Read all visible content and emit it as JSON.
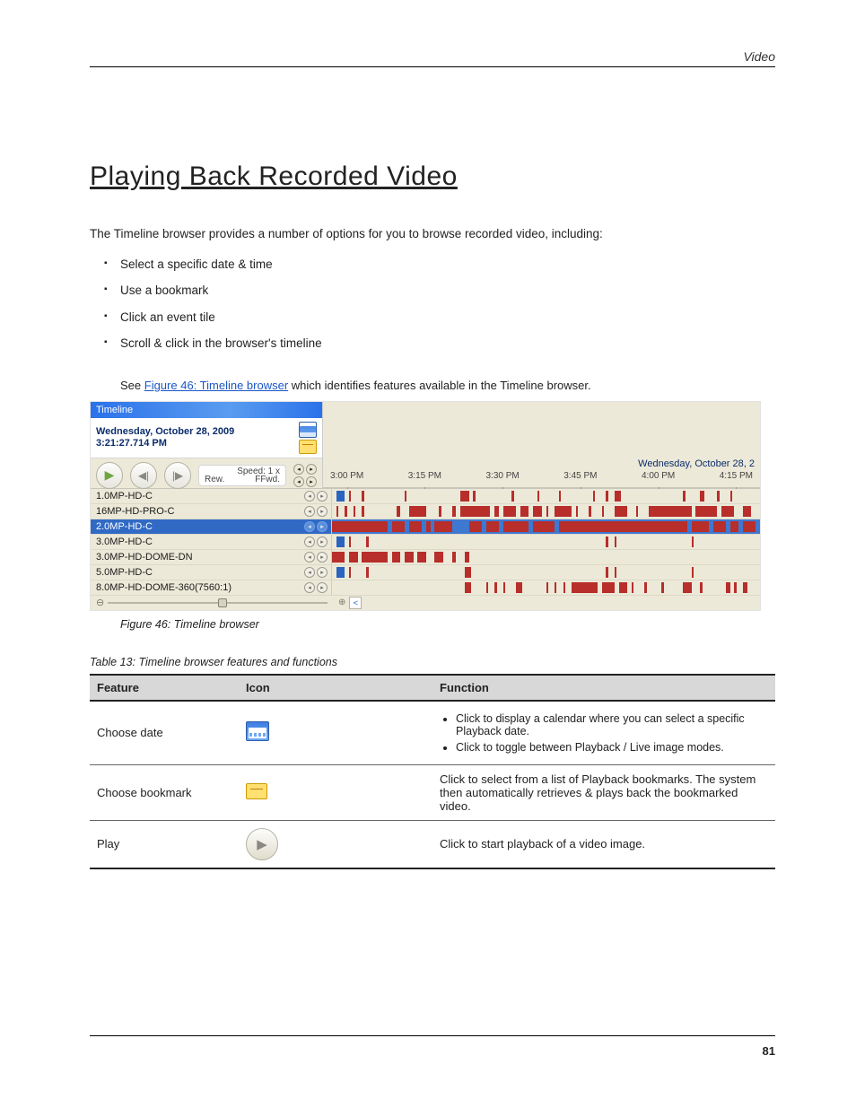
{
  "header": {
    "section": "Video"
  },
  "title": "Playing Back Recorded Video",
  "intro": {
    "para": "The Timeline browser provides a number of options for you to browse recorded video, including:",
    "bullets": [
      "Select a specific date & time",
      "Use a bookmark",
      "Click an event tile",
      "Scroll & click in the browser's timeline"
    ]
  },
  "caption": {
    "seePrefix": "See ",
    "figref": "Figure 46: Timeline browser",
    "after": " which identifies features available in the Timeline browser."
  },
  "screenshot": {
    "titlebar": "Timeline",
    "date": "Wednesday, October 28, 2009",
    "time": "3:21:27.714 PM",
    "speed_label": "Speed: 1 x",
    "rew": "Rew.",
    "ffwd": "FFwd.",
    "ruler_date": "Wednesday, October 28, 2",
    "ruler_times": [
      "3:00 PM",
      "3:15 PM",
      "3:30 PM",
      "3:45 PM",
      "4:00 PM",
      "4:15 PM"
    ],
    "rows": [
      "1.0MP-HD-C",
      "16MP-HD-PRO-C",
      "2.0MP-HD-C",
      "3.0MP-HD-C",
      "3.0MP-HD-DOME-DN",
      "5.0MP-HD-C",
      "8.0MP-HD-DOME-360(7560:1)"
    ]
  },
  "figlabel": "Figure 46: Timeline browser",
  "table": {
    "caption": "Table 13: Timeline browser features and functions",
    "headers": [
      "Feature",
      "Icon",
      "Function"
    ],
    "rows": [
      {
        "feature": "Choose date",
        "function_items": [
          "Click to display a calendar where you can select a specific Playback date.",
          "Click to toggle between Playback / Live image modes."
        ]
      },
      {
        "feature": "Choose bookmark",
        "function": "Click to select from a list of Playback bookmarks. The system then automatically retrieves & plays back the bookmarked video."
      },
      {
        "feature": "Play",
        "function": "Click to start playback of a video image."
      }
    ]
  },
  "pagenum": "81"
}
